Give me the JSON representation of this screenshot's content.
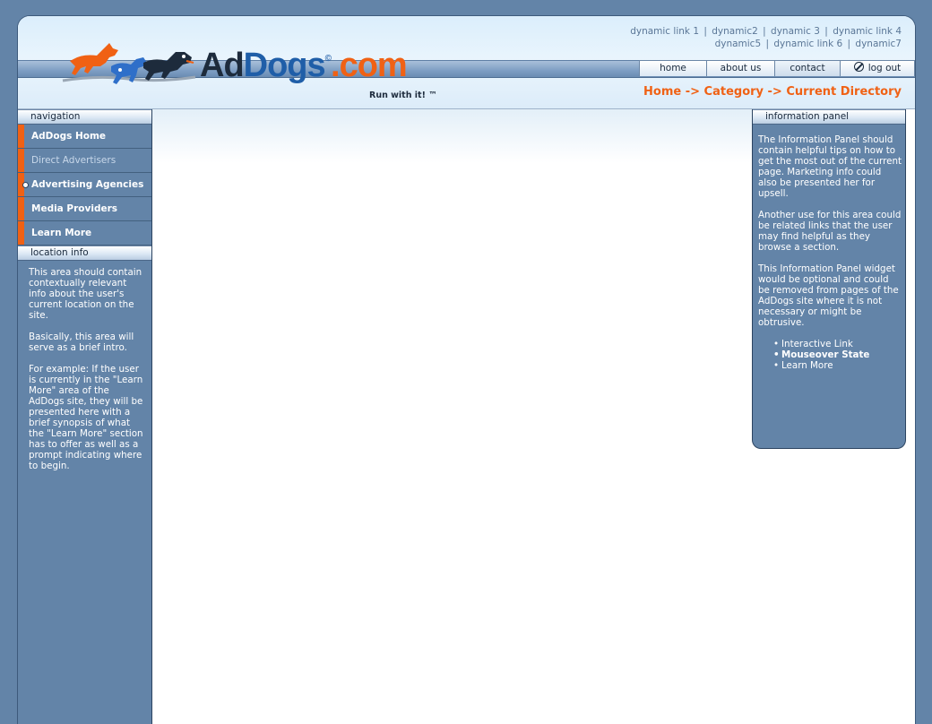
{
  "header": {
    "dynamic_links_row1": [
      "dynamic link 1",
      "dynamic2",
      "dynamic 3",
      "dynamic link 4"
    ],
    "dynamic_links_row2": [
      "dynamic5",
      "dynamic link 6",
      "dynamic7"
    ],
    "separator": "|",
    "logo": {
      "ad": "Ad",
      "dogs": "Dogs",
      "copyright": "©",
      "com": ".com",
      "tagline": "Run with it! ™"
    },
    "nav": {
      "home": "home",
      "about": "about us",
      "contact": "contact",
      "logout": "log out"
    },
    "breadcrumb": "Home -> Category -> Current Directory"
  },
  "sidebar": {
    "nav_title": "navigation",
    "items": [
      {
        "label": "AdDogs Home"
      },
      {
        "label": "Direct Advertisers"
      },
      {
        "label": "Advertising Agencies"
      },
      {
        "label": "Media Providers"
      },
      {
        "label": "Learn More"
      }
    ],
    "location_title": "location info",
    "location_paragraphs": [
      "This area should contain contextually relevant info about the user's current location on the site.",
      "Basically, this area will serve as a brief intro.",
      "For example: If the user is currently in the \"Learn More\" area of the AdDogs site, they will be presented here with a brief synopsis of what the \"Learn More\" section has to offer as well as a prompt indicating where to begin."
    ]
  },
  "info_panel": {
    "title": "information panel",
    "paragraphs": [
      "The Information Panel should contain helpful tips on how to get the most out of the current page. Marketing info could also be presented her for upsell.",
      "Another use for this area could be related links that the user may find helpful as they browse a section.",
      "This Information Panel widget would be optional and could be removed from pages of the AdDogs site where it is not necessary or might be obtrusive."
    ],
    "links": [
      "Interactive Link",
      "Mouseover State",
      "Learn More"
    ]
  },
  "colors": {
    "accent": "#f06114",
    "brand_blue": "#1f5ea8",
    "panel": "#6384a8"
  }
}
